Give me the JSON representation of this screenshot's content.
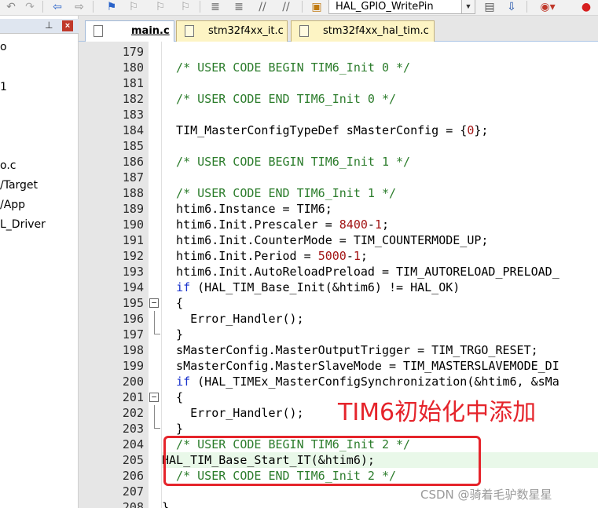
{
  "toolbar": {
    "function_combo": "HAL_GPIO_WritePin",
    "colors": {
      "accent": "#2a63c9"
    },
    "icons": [
      "undo-icon",
      "redo-icon",
      "back-icon",
      "forward-icon",
      "bookmark-icon",
      "bookmark-prev-icon",
      "bookmark-next-icon",
      "bookmark-clear-icon",
      "indent-icon",
      "unindent-icon",
      "comment-icon",
      "uncomment-icon",
      "find-in-files-icon",
      "combo-dropdown-icon",
      "config-icon",
      "download-icon",
      "debug-icon",
      "breakpoint-icon"
    ]
  },
  "project_panel": {
    "pin_icon": "pin-icon",
    "close_icon": "close-icon",
    "items": [
      {
        "label": "o"
      },
      {
        "label": "1"
      },
      {
        "label": "o.c"
      },
      {
        "label": "/Target"
      },
      {
        "label": "/App"
      },
      {
        "label": "L_Driver"
      }
    ]
  },
  "tabs": [
    {
      "label": "main.c",
      "active": true
    },
    {
      "label": "stm32f4xx_it.c",
      "active": false
    },
    {
      "label": "stm32f4xx_hal_tim.c",
      "active": false
    }
  ],
  "editor": {
    "lines": [
      {
        "num": "179",
        "code": ""
      },
      {
        "num": "180",
        "code": "  /* USER CODE BEGIN TIM6_Init 0 */"
      },
      {
        "num": "181",
        "code": ""
      },
      {
        "num": "182",
        "code": "  /* USER CODE END TIM6_Init 0 */"
      },
      {
        "num": "183",
        "code": ""
      },
      {
        "num": "184",
        "code": "  TIM_MasterConfigTypeDef sMasterConfig = {0};"
      },
      {
        "num": "185",
        "code": ""
      },
      {
        "num": "186",
        "code": "  /* USER CODE BEGIN TIM6_Init 1 */"
      },
      {
        "num": "187",
        "code": ""
      },
      {
        "num": "188",
        "code": "  /* USER CODE END TIM6_Init 1 */"
      },
      {
        "num": "189",
        "code": "  htim6.Instance = TIM6;"
      },
      {
        "num": "190",
        "code": "  htim6.Init.Prescaler = 8400-1;"
      },
      {
        "num": "191",
        "code": "  htim6.Init.CounterMode = TIM_COUNTERMODE_UP;"
      },
      {
        "num": "192",
        "code": "  htim6.Init.Period = 5000-1;"
      },
      {
        "num": "193",
        "code": "  htim6.Init.AutoReloadPreload = TIM_AUTORELOAD_PRELOAD_"
      },
      {
        "num": "194",
        "code": "  if (HAL_TIM_Base_Init(&htim6) != HAL_OK)"
      },
      {
        "num": "195",
        "code": "  {"
      },
      {
        "num": "196",
        "code": "    Error_Handler();"
      },
      {
        "num": "197",
        "code": "  }"
      },
      {
        "num": "198",
        "code": "  sMasterConfig.MasterOutputTrigger = TIM_TRGO_RESET;"
      },
      {
        "num": "199",
        "code": "  sMasterConfig.MasterSlaveMode = TIM_MASTERSLAVEMODE_DI"
      },
      {
        "num": "200",
        "code": "  if (HAL_TIMEx_MasterConfigSynchronization(&htim6, &sMa"
      },
      {
        "num": "201",
        "code": "  {"
      },
      {
        "num": "202",
        "code": "    Error_Handler();"
      },
      {
        "num": "203",
        "code": "  }"
      },
      {
        "num": "204",
        "code": "  /* USER CODE BEGIN TIM6_Init 2 */"
      },
      {
        "num": "205",
        "code": "HAL_TIM_Base_Start_IT(&htim6);"
      },
      {
        "num": "206",
        "code": "  /* USER CODE END TIM6_Init 2 */"
      },
      {
        "num": "207",
        "code": ""
      },
      {
        "num": "208",
        "code": "}"
      }
    ]
  },
  "annotation": {
    "text": "TIM6初始化中添加",
    "color": "#e5242b"
  },
  "watermark": "CSDN @骑着毛驴数星星"
}
